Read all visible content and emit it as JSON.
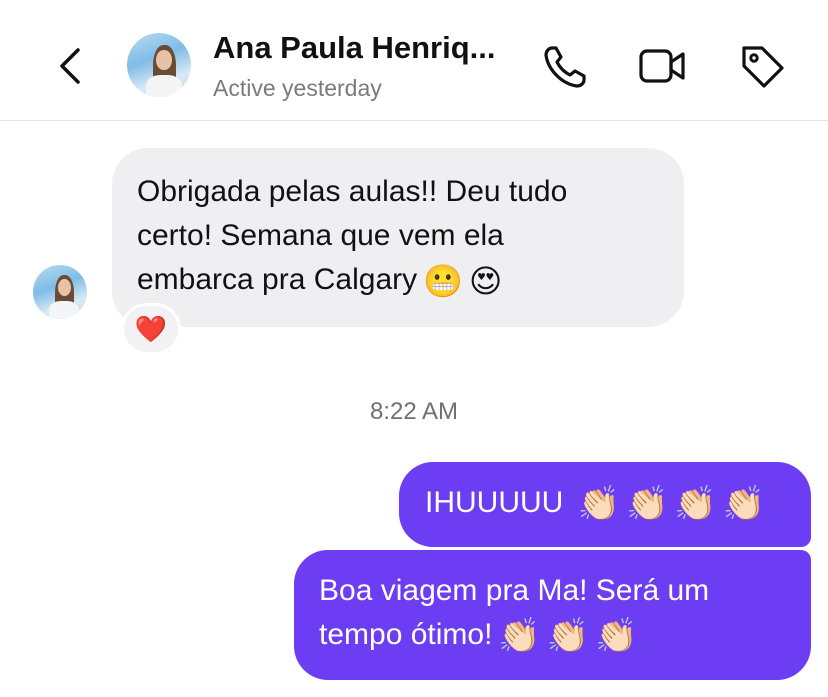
{
  "header": {
    "contact_name": "Ana Paula Henriq...",
    "status": "Active yesterday",
    "icons": [
      "back-chevron-icon",
      "phone-icon",
      "video-camera-icon",
      "tag-icon"
    ]
  },
  "messages": {
    "incoming": {
      "line1": "Obrigada pelas aulas!! Deu tudo",
      "line2": "certo! Semana que vem ela",
      "line3": "embarca pra Calgary",
      "emoji1": "😬",
      "emoji2": "😍",
      "reaction": "❤️"
    },
    "timestamp": "8:22 AM",
    "outgoing": [
      {
        "text": "IHUUUUU",
        "claps": [
          "👏🏻",
          "👏🏻",
          "👏🏻",
          "👏🏻"
        ]
      },
      {
        "line1": "Boa viagem pra Ma! Será um",
        "line2": "tempo ótimo!",
        "claps": [
          "👏🏻",
          "👏🏻",
          "👏🏻"
        ]
      }
    ]
  },
  "colors": {
    "outgoing_bubble": "#6c3df3",
    "incoming_bubble": "#efeff1",
    "status_text": "#7a7a80"
  }
}
